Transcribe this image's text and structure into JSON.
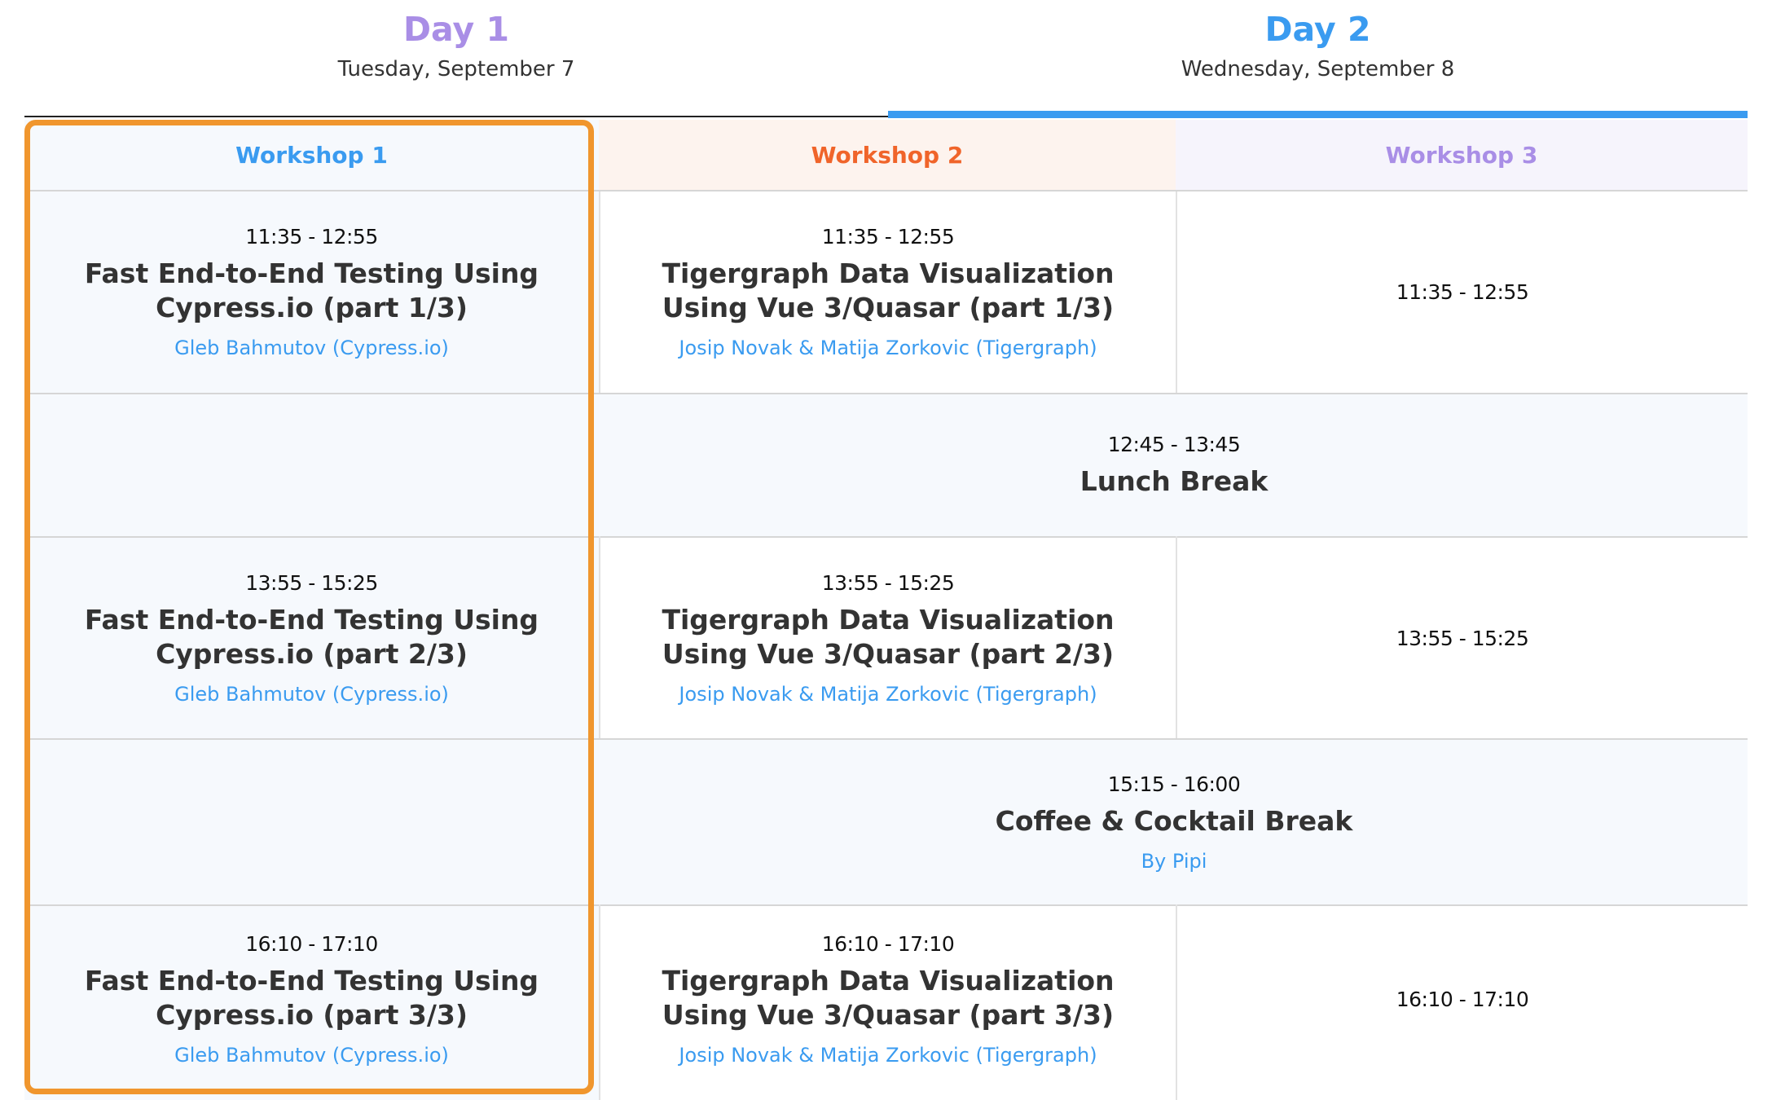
{
  "colors": {
    "day1": "#a98ee6",
    "day2": "#3a9bf0",
    "workshop1": "#3a9bf0",
    "workshop2": "#f0642a",
    "workshop3": "#a98ee6",
    "highlight": "#f0962e",
    "speaker": "#3a9bf0"
  },
  "days": [
    {
      "title": "Day 1",
      "date": "Tuesday, September 7"
    },
    {
      "title": "Day 2",
      "date": "Wednesday, September 8"
    }
  ],
  "workshops": [
    "Workshop 1",
    "Workshop 2",
    "Workshop 3"
  ],
  "slots": [
    {
      "w1": {
        "time": "11:35 - 12:55",
        "title": "Fast End-to-End Testing Using Cypress.io (part 1/3)",
        "speaker": "Gleb Bahmutov (Cypress.io)"
      },
      "w2": {
        "time": "11:35 - 12:55",
        "title": "Tigergraph Data Visualization Using Vue 3/Quasar (part 1/3)",
        "speaker": "Josip Novak & Matija Zorkovic (Tigergraph)"
      },
      "w3": {
        "time": "11:35 - 12:55"
      }
    },
    {
      "break": {
        "time": "12:45 - 13:45",
        "title": "Lunch Break"
      }
    },
    {
      "w1": {
        "time": "13:55 - 15:25",
        "title": "Fast End-to-End Testing Using Cypress.io (part 2/3)",
        "speaker": "Gleb Bahmutov (Cypress.io)"
      },
      "w2": {
        "time": "13:55 - 15:25",
        "title": "Tigergraph Data Visualization Using Vue 3/Quasar (part 2/3)",
        "speaker": "Josip Novak & Matija Zorkovic (Tigergraph)"
      },
      "w3": {
        "time": "13:55 - 15:25"
      }
    },
    {
      "break": {
        "time": "15:15 - 16:00",
        "title": "Coffee & Cocktail Break",
        "speaker": "By Pipi"
      }
    },
    {
      "w1": {
        "time": "16:10 - 17:10",
        "title": "Fast End-to-End Testing Using Cypress.io (part 3/3)",
        "speaker": "Gleb Bahmutov (Cypress.io)"
      },
      "w2": {
        "time": "16:10 - 17:10",
        "title": "Tigergraph Data Visualization Using Vue 3/Quasar (part 3/3)",
        "speaker": "Josip Novak & Matija Zorkovic (Tigergraph)"
      },
      "w3": {
        "time": "16:10 - 17:10"
      }
    }
  ]
}
